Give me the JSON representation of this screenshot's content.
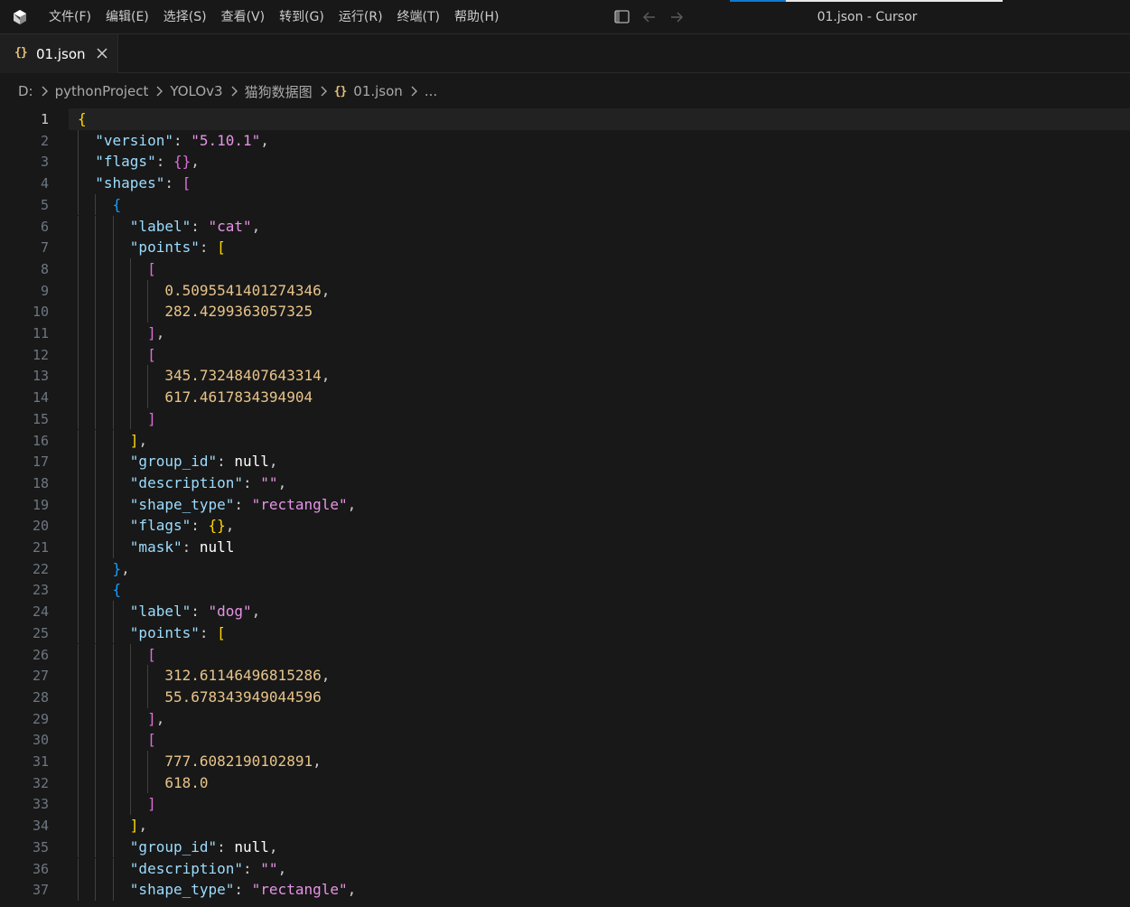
{
  "window": {
    "title": "01.json - Cursor",
    "menu": [
      "文件(F)",
      "编辑(E)",
      "选择(S)",
      "查看(V)",
      "转到(G)",
      "运行(R)",
      "终端(T)",
      "帮助(H)"
    ]
  },
  "tab": {
    "icon_glyph": "{}",
    "label": "01.json"
  },
  "breadcrumb": {
    "parts": [
      "D:",
      "pythonProject",
      "YOLOv3",
      "猫狗数据图"
    ],
    "file_icon": "{}",
    "file": "01.json",
    "ellipsis": "..."
  },
  "editor": {
    "active_line": 1,
    "lines": [
      [
        [
          "b1",
          "{"
        ]
      ],
      [
        [
          "w",
          "  "
        ],
        [
          "key",
          "\"version\""
        ],
        [
          "w",
          ": "
        ],
        [
          "str",
          "\"5.10.1\""
        ],
        [
          "w",
          ","
        ]
      ],
      [
        [
          "w",
          "  "
        ],
        [
          "key",
          "\"flags\""
        ],
        [
          "w",
          ": "
        ],
        [
          "b2",
          "{}"
        ],
        [
          "w",
          ","
        ]
      ],
      [
        [
          "w",
          "  "
        ],
        [
          "key",
          "\"shapes\""
        ],
        [
          "w",
          ": "
        ],
        [
          "b2",
          "["
        ]
      ],
      [
        [
          "w",
          "    "
        ],
        [
          "b3",
          "{"
        ]
      ],
      [
        [
          "w",
          "      "
        ],
        [
          "key",
          "\"label\""
        ],
        [
          "w",
          ": "
        ],
        [
          "str",
          "\"cat\""
        ],
        [
          "w",
          ","
        ]
      ],
      [
        [
          "w",
          "      "
        ],
        [
          "key",
          "\"points\""
        ],
        [
          "w",
          ": "
        ],
        [
          "b1",
          "["
        ]
      ],
      [
        [
          "w",
          "        "
        ],
        [
          "b2",
          "["
        ]
      ],
      [
        [
          "w",
          "          "
        ],
        [
          "num",
          "0.5095541401274346"
        ],
        [
          "w",
          ","
        ]
      ],
      [
        [
          "w",
          "          "
        ],
        [
          "num",
          "282.4299363057325"
        ]
      ],
      [
        [
          "w",
          "        "
        ],
        [
          "b2",
          "]"
        ],
        [
          "w",
          ","
        ]
      ],
      [
        [
          "w",
          "        "
        ],
        [
          "b2",
          "["
        ]
      ],
      [
        [
          "w",
          "          "
        ],
        [
          "num",
          "345.73248407643314"
        ],
        [
          "w",
          ","
        ]
      ],
      [
        [
          "w",
          "          "
        ],
        [
          "num",
          "617.4617834394904"
        ]
      ],
      [
        [
          "w",
          "        "
        ],
        [
          "b2",
          "]"
        ]
      ],
      [
        [
          "w",
          "      "
        ],
        [
          "b1",
          "]"
        ],
        [
          "w",
          ","
        ]
      ],
      [
        [
          "w",
          "      "
        ],
        [
          "key",
          "\"group_id\""
        ],
        [
          "w",
          ": "
        ],
        [
          "nul",
          "null"
        ],
        [
          "w",
          ","
        ]
      ],
      [
        [
          "w",
          "      "
        ],
        [
          "key",
          "\"description\""
        ],
        [
          "w",
          ": "
        ],
        [
          "str",
          "\"\""
        ],
        [
          "w",
          ","
        ]
      ],
      [
        [
          "w",
          "      "
        ],
        [
          "key",
          "\"shape_type\""
        ],
        [
          "w",
          ": "
        ],
        [
          "str",
          "\"rectangle\""
        ],
        [
          "w",
          ","
        ]
      ],
      [
        [
          "w",
          "      "
        ],
        [
          "key",
          "\"flags\""
        ],
        [
          "w",
          ": "
        ],
        [
          "b1",
          "{}"
        ],
        [
          "w",
          ","
        ]
      ],
      [
        [
          "w",
          "      "
        ],
        [
          "key",
          "\"mask\""
        ],
        [
          "w",
          ": "
        ],
        [
          "nul",
          "null"
        ]
      ],
      [
        [
          "w",
          "    "
        ],
        [
          "b3",
          "}"
        ],
        [
          "w",
          ","
        ]
      ],
      [
        [
          "w",
          "    "
        ],
        [
          "b3",
          "{"
        ]
      ],
      [
        [
          "w",
          "      "
        ],
        [
          "key",
          "\"label\""
        ],
        [
          "w",
          ": "
        ],
        [
          "str",
          "\"dog\""
        ],
        [
          "w",
          ","
        ]
      ],
      [
        [
          "w",
          "      "
        ],
        [
          "key",
          "\"points\""
        ],
        [
          "w",
          ": "
        ],
        [
          "b1",
          "["
        ]
      ],
      [
        [
          "w",
          "        "
        ],
        [
          "b2",
          "["
        ]
      ],
      [
        [
          "w",
          "          "
        ],
        [
          "num",
          "312.61146496815286"
        ],
        [
          "w",
          ","
        ]
      ],
      [
        [
          "w",
          "          "
        ],
        [
          "num",
          "55.678343949044596"
        ]
      ],
      [
        [
          "w",
          "        "
        ],
        [
          "b2",
          "]"
        ],
        [
          "w",
          ","
        ]
      ],
      [
        [
          "w",
          "        "
        ],
        [
          "b2",
          "["
        ]
      ],
      [
        [
          "w",
          "          "
        ],
        [
          "num",
          "777.6082190102891"
        ],
        [
          "w",
          ","
        ]
      ],
      [
        [
          "w",
          "          "
        ],
        [
          "num",
          "618.0"
        ]
      ],
      [
        [
          "w",
          "        "
        ],
        [
          "b2",
          "]"
        ]
      ],
      [
        [
          "w",
          "      "
        ],
        [
          "b1",
          "]"
        ],
        [
          "w",
          ","
        ]
      ],
      [
        [
          "w",
          "      "
        ],
        [
          "key",
          "\"group_id\""
        ],
        [
          "w",
          ": "
        ],
        [
          "nul",
          "null"
        ],
        [
          "w",
          ","
        ]
      ],
      [
        [
          "w",
          "      "
        ],
        [
          "key",
          "\"description\""
        ],
        [
          "w",
          ": "
        ],
        [
          "str",
          "\"\""
        ],
        [
          "w",
          ","
        ]
      ],
      [
        [
          "w",
          "      "
        ],
        [
          "key",
          "\"shape_type\""
        ],
        [
          "w",
          ": "
        ],
        [
          "str",
          "\"rectangle\""
        ],
        [
          "w",
          ","
        ]
      ]
    ]
  },
  "colors": {
    "accent": "#0e7ad1",
    "json_key": "#9cdcfe",
    "json_string": "#e694e6",
    "json_number": "#e8c48a",
    "bracket_level1": "#ffd700",
    "bracket_level2": "#da70d6",
    "bracket_level3": "#179fff"
  },
  "icons": [
    "cursor-logo-icon",
    "layout-sidebar-icon",
    "arrow-left-icon",
    "arrow-right-icon",
    "close-icon",
    "chevron-right-icon",
    "json-file-icon"
  ]
}
